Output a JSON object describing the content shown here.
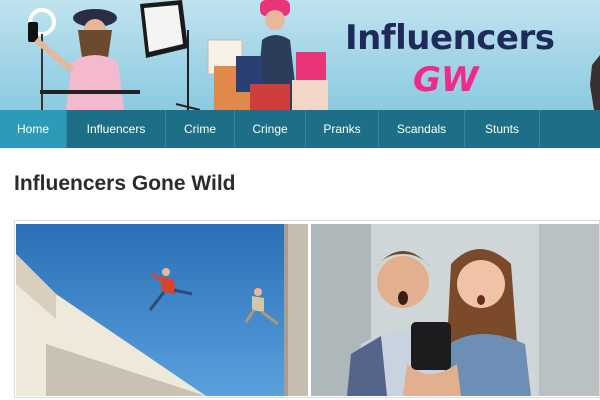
{
  "header": {
    "logo_main": "Influencers",
    "logo_sub": "GW",
    "brand_colors": {
      "navy": "#1f2a5a",
      "pink": "#ef2a8a",
      "nav": "#1c6f86",
      "nav_active": "#2b9bb7"
    }
  },
  "nav": {
    "items": [
      {
        "label": "Home",
        "active": true
      },
      {
        "label": "Influencers"
      },
      {
        "label": "Crime"
      },
      {
        "label": "Cringe"
      },
      {
        "label": "Pranks"
      },
      {
        "label": "Scandals"
      },
      {
        "label": "Stunts"
      }
    ]
  },
  "main": {
    "title": "Influencers Gone Wild"
  }
}
